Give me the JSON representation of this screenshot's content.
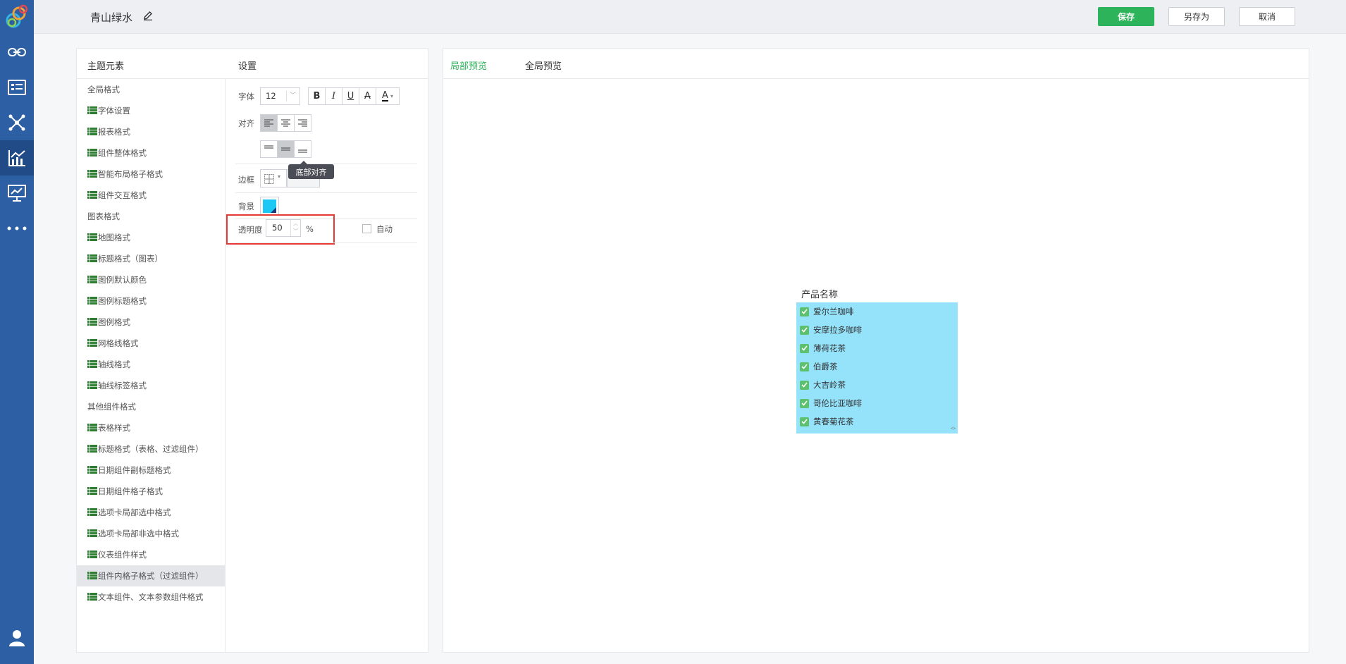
{
  "theme": {
    "name": "青山绿水"
  },
  "toolbar": {
    "save": "保存",
    "save_as": "另存为",
    "cancel": "取消"
  },
  "panel": {
    "elements_title": "主题元素",
    "settings_title": "设置"
  },
  "elements": [
    {
      "label": "全局格式",
      "kind": "category"
    },
    {
      "label": "字体设置",
      "kind": "item"
    },
    {
      "label": "报表格式",
      "kind": "item"
    },
    {
      "label": "组件整体格式",
      "kind": "item"
    },
    {
      "label": "智能布局格子格式",
      "kind": "item"
    },
    {
      "label": "组件交互格式",
      "kind": "item"
    },
    {
      "label": "图表格式",
      "kind": "category"
    },
    {
      "label": "地图格式",
      "kind": "item"
    },
    {
      "label": "标题格式（图表）",
      "kind": "item"
    },
    {
      "label": "图例默认颜色",
      "kind": "item"
    },
    {
      "label": "图例标题格式",
      "kind": "item"
    },
    {
      "label": "图例格式",
      "kind": "item"
    },
    {
      "label": "网格线格式",
      "kind": "item"
    },
    {
      "label": "轴线格式",
      "kind": "item"
    },
    {
      "label": "轴线标签格式",
      "kind": "item"
    },
    {
      "label": "其他组件格式",
      "kind": "category"
    },
    {
      "label": "表格样式",
      "kind": "item"
    },
    {
      "label": "标题格式（表格、过滤组件）",
      "kind": "item"
    },
    {
      "label": "日期组件副标题格式",
      "kind": "item"
    },
    {
      "label": "日期组件格子格式",
      "kind": "item"
    },
    {
      "label": "选项卡局部选中格式",
      "kind": "item"
    },
    {
      "label": "选项卡局部非选中格式",
      "kind": "item"
    },
    {
      "label": "仪表组件样式",
      "kind": "item"
    },
    {
      "label": "组件内格子格式（过滤组件）",
      "kind": "item",
      "selected": true
    },
    {
      "label": "文本组件、文本参数组件格式",
      "kind": "item"
    }
  ],
  "settings": {
    "font_label": "字体",
    "font_size": "12",
    "align_label": "对齐",
    "border_label": "边框",
    "background_label": "背景",
    "background_color": "#1ec8f5",
    "tooltip": "底部对齐",
    "opacity_label": "透明度",
    "opacity_value": "50",
    "opacity_unit": "%",
    "auto_label": "自动"
  },
  "preview": {
    "tab_local": "局部预览",
    "tab_global": "全局预览",
    "filter_title": "产品名称",
    "items": [
      "爱尔兰咖啡",
      "安摩拉多咖啡",
      "薄荷花茶",
      "伯爵茶",
      "大吉岭茶",
      "哥伦比亚咖啡",
      "黄春菊花茶"
    ]
  },
  "colors": {
    "nav": "#2c5fa3",
    "accent": "#2db359",
    "filter_bg": "#94e3fb",
    "highlight_border": "#e53935"
  }
}
